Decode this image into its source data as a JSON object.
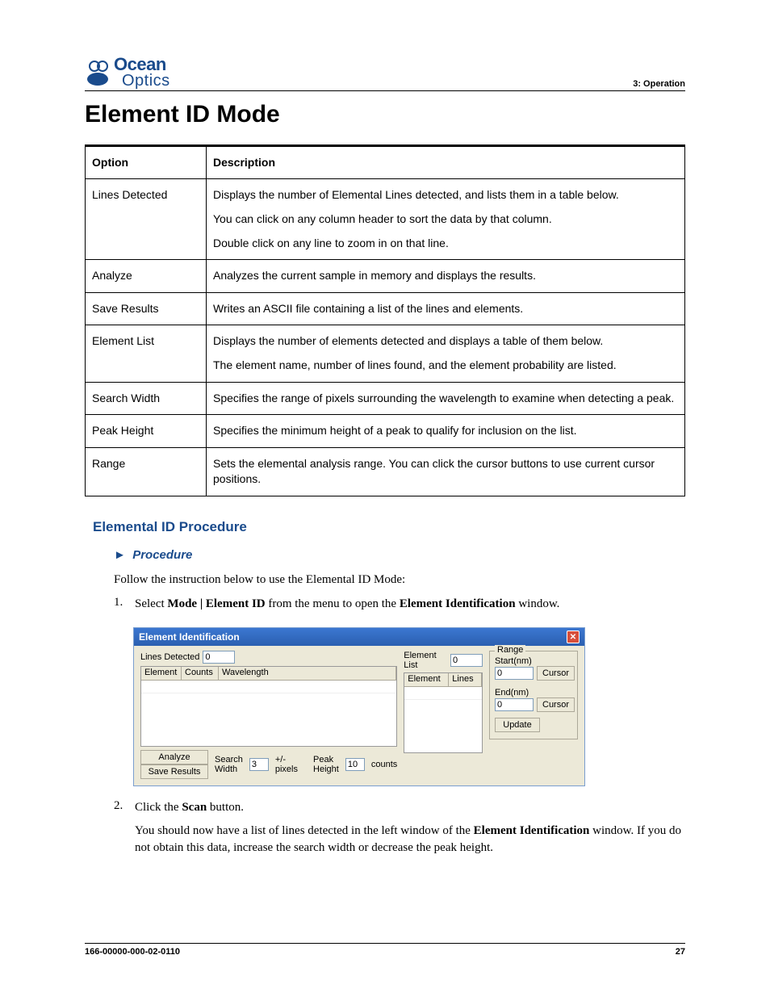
{
  "header": {
    "logo_line1": "Ocean",
    "logo_line2": "Optics",
    "section": "3: Operation"
  },
  "title": "Element ID Mode",
  "table": {
    "headers": {
      "option": "Option",
      "description": "Description"
    },
    "rows": [
      {
        "option": "Lines Detected",
        "desc": [
          "Displays the number of Elemental Lines detected, and lists them in a table below.",
          "You can click on any column header to sort the data by that column.",
          "Double click on any line to zoom in on that line."
        ]
      },
      {
        "option": "Analyze",
        "desc": [
          "Analyzes the current sample in memory and displays the results."
        ]
      },
      {
        "option": "Save Results",
        "desc": [
          "Writes an ASCII file containing a list of the lines and elements."
        ]
      },
      {
        "option": "Element List",
        "desc": [
          "Displays the number of elements detected and displays a table of them below.",
          "The element name, number of lines found, and the element probability are listed."
        ]
      },
      {
        "option": "Search Width",
        "desc": [
          "Specifies the range of pixels surrounding the wavelength to examine when detecting a peak."
        ]
      },
      {
        "option": "Peak Height",
        "desc": [
          "Specifies the minimum height of a peak to qualify for inclusion on the list."
        ]
      },
      {
        "option": "Range",
        "desc": [
          "Sets the elemental analysis range. You can click the cursor buttons to use current cursor positions."
        ]
      }
    ]
  },
  "procedure": {
    "heading": "Elemental ID Procedure",
    "label": "Procedure",
    "intro": "Follow the instruction below to use the Elemental ID Mode:",
    "steps": [
      {
        "num": "1.",
        "parts": [
          {
            "t": "Select "
          },
          {
            "t": "Mode | Element ID",
            "b": true
          },
          {
            "t": " from the menu to open the "
          },
          {
            "t": "Element Identification",
            "b": true
          },
          {
            "t": " window."
          }
        ]
      },
      {
        "num": "2.",
        "parts": [
          {
            "t": "Click the "
          },
          {
            "t": "Scan",
            "b": true
          },
          {
            "t": " button."
          }
        ],
        "followup_parts": [
          {
            "t": "You should now have a list of lines detected in the left window of the "
          },
          {
            "t": "Element Identification",
            "b": true
          },
          {
            "t": " window. If you do not obtain this data, increase the search width or decrease the peak height."
          }
        ]
      }
    ]
  },
  "window": {
    "title": "Element Identification",
    "lines_detected_label": "Lines Detected",
    "lines_detected_value": "0",
    "element_list_label": "Element List",
    "element_list_value": "0",
    "left_columns": [
      "Element",
      "Counts",
      "Wavelength"
    ],
    "right_columns": [
      "Element",
      "Lines"
    ],
    "range_legend": "Range",
    "start_label": "Start(nm)",
    "start_value": "0",
    "end_label": "End(nm)",
    "end_value": "0",
    "cursor_button": "Cursor",
    "update_button": "Update",
    "analyze_button": "Analyze",
    "save_button": "Save Results",
    "search_width_label": "Search Width",
    "search_width_value": "3",
    "pixels_label": "+/- pixels",
    "peak_height_label": "Peak Height",
    "peak_height_value": "10",
    "counts_label": "counts"
  },
  "footer": {
    "doc_number": "166-00000-000-02-0110",
    "page": "27"
  }
}
